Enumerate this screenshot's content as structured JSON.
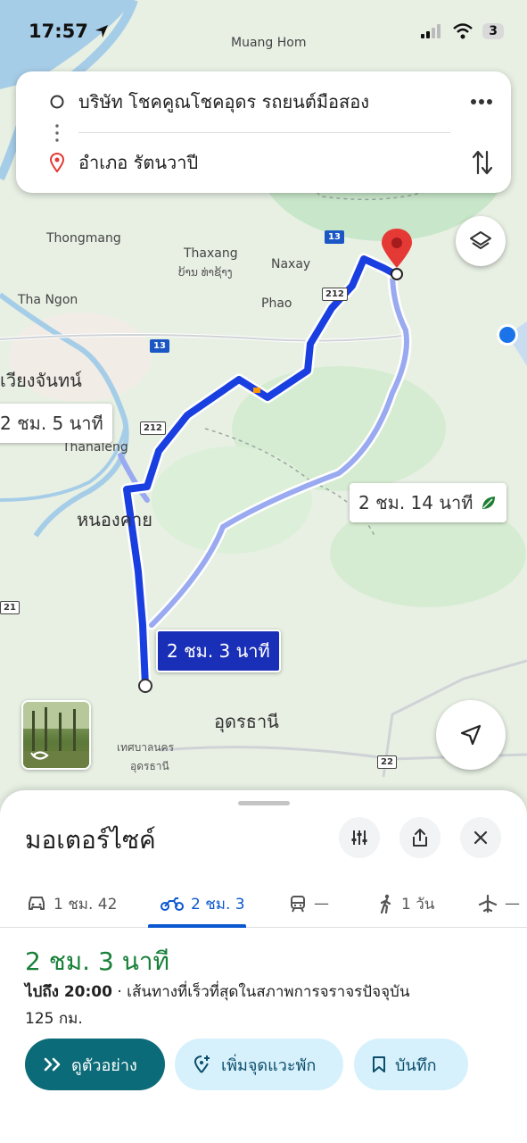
{
  "status_bar": {
    "time": "17:57",
    "battery": "3"
  },
  "search": {
    "origin": "บริษัท โชคคูณโชคอุดร รถยนต์มือสอง",
    "destination": "อำเภอ รัตนวาปี"
  },
  "map": {
    "labels": {
      "muang_hom": "Muang Hom",
      "thongmang": "Thongmang",
      "thaxang": "Thaxang",
      "thaxang_lao": "ບ້ານ ທ່າຊ້າງ",
      "naxay": "Naxay",
      "phao": "Phao",
      "tha_ngon": "Tha Ngon",
      "vientiane": "เวียงจันทน์",
      "thanaleng": "Thanaleng",
      "nong_khai": "หนองคาย",
      "udon": "อุดรธานี",
      "udon_city_1": "เทศบาลนคร",
      "udon_city_2": "อุดรธานี",
      "shield_13a": "13",
      "shield_13b": "13",
      "shield_212a": "212",
      "shield_212b": "212",
      "shield_22": "22",
      "shield_21": "21"
    },
    "route_bubbles": {
      "left_alt": "2 ชม. 5 นาที",
      "right_alt": "2 ชม. 14 นาที",
      "selected": "2 ชม. 3 นาที"
    },
    "colors": {
      "route_selected": "#1a3fe0",
      "route_alt": "#9aaaf0",
      "water": "#a6cde8",
      "land": "#e8f0e4",
      "destination_pin": "#e53935"
    }
  },
  "sheet": {
    "title": "มอเตอร์ไซค์",
    "tabs": [
      {
        "icon": "car-icon",
        "label": "1 ชม. 42"
      },
      {
        "icon": "motorcycle-icon",
        "label": "2 ชม. 3"
      },
      {
        "icon": "train-icon",
        "label": "—"
      },
      {
        "icon": "walk-icon",
        "label": "1 วัน"
      },
      {
        "icon": "flight-icon",
        "label": "—"
      }
    ],
    "duration": "2 ชม. 3 นาที",
    "arrive_prefix": "ไปถึง 20:00",
    "arrive_suffix": " · เส้นทางที่เร็วที่สุดในสภาพการจราจรปัจจุบัน",
    "distance": "125 กม.",
    "actions": {
      "preview": "ดูตัวอย่าง",
      "add_stop": "เพิ่มจุดแวะพัก",
      "save": "บันทึก"
    }
  }
}
